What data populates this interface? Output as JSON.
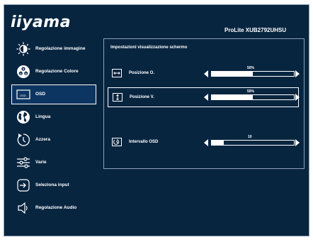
{
  "header": {
    "logo": "iiyama",
    "model": "ProLite XUB2792UHSU"
  },
  "menu": [
    {
      "label": "Regolazione immagine",
      "icon": "brightness-icon",
      "selected": false
    },
    {
      "label": "Regolazione Colore",
      "icon": "color-palette-icon",
      "selected": false
    },
    {
      "label": "OSD",
      "icon": "osd-icon",
      "selected": true
    },
    {
      "label": "Lingua",
      "icon": "globe-icon",
      "selected": false
    },
    {
      "label": "Azzera",
      "icon": "reset-icon",
      "selected": false
    },
    {
      "label": "Varie",
      "icon": "sliders-icon",
      "selected": false
    },
    {
      "label": "Seleziona input",
      "icon": "input-icon",
      "selected": false
    },
    {
      "label": "Regolazione Audio",
      "icon": "speaker-icon",
      "selected": false
    }
  ],
  "osd_icon_text": "OSD",
  "panel": {
    "title": "Impostazioni visualizzazione schermo",
    "rows": [
      {
        "label": "Posizione O.",
        "icon": "horizontal-position-icon",
        "value": "50%",
        "level": 0.5,
        "selected": false
      },
      {
        "label": "Posizione V.",
        "icon": "vertical-position-icon",
        "value": "50%",
        "level": 0.5,
        "selected": true
      },
      {
        "label": "Intervallo OSD",
        "icon": "timer-icon",
        "value": "10",
        "level": 0.15,
        "selected": false
      }
    ]
  },
  "colors": {
    "background": "#082540",
    "selected_background": "#0d3561",
    "foreground": "#ffffff"
  }
}
